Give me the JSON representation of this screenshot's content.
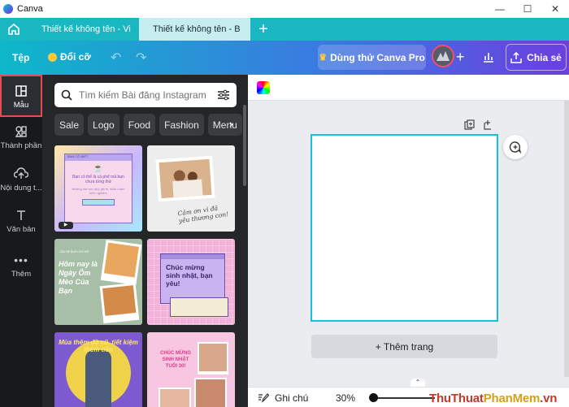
{
  "window": {
    "title": "Canva",
    "controls": [
      "—",
      "☐",
      "✕"
    ]
  },
  "tabs": [
    {
      "label": "Thiết kế không tên - Vi",
      "active": false
    },
    {
      "label": "Thiết kế không tên - B",
      "active": true
    }
  ],
  "toolbar": {
    "file": "Tệp",
    "resize": "Đổi cỡ",
    "trial": "Dùng thử Canva Pro",
    "share": "Chia sẻ"
  },
  "rail": [
    {
      "label": "Mẫu",
      "icon": "template-icon",
      "active": true
    },
    {
      "label": "Thành phần",
      "icon": "elements-icon",
      "active": false
    },
    {
      "label": "Nội dung t...",
      "icon": "upload-icon",
      "active": false
    },
    {
      "label": "Văn bản",
      "icon": "text-icon",
      "active": false
    },
    {
      "label": "Thêm",
      "icon": "more-icon",
      "active": false
    }
  ],
  "panel": {
    "search_placeholder": "Tìm kiếm Bài đăng Instagram mẫu",
    "chips": [
      "Sale",
      "Logo",
      "Food",
      "Fashion",
      "Menu"
    ]
  },
  "templates": {
    "t1_header": "BẠN CÓ BIẾT",
    "t1_text": "Bạn có thể là cà phê mà bạn chưa từng thử",
    "t1_body": "Những bài học quý giá từ nhiều năm kinh nghiệm",
    "t2_text": "Cảm ơn vì đã yêu thương con!",
    "t3_label": "CÂU BÉ BUỔI GIỜ ĐÓ",
    "t3_text": "Hôm nay là Ngày Ôm Mèo Của Bạn",
    "t4_text": "Chúc mừng sinh nhật, bạn yêu!",
    "t5_text": "Mùa thêm đồ cũ, tiết kiệm thêm tiền",
    "t6_text": "CHÚC MỪNG SINH NHẬT TUỔI 30!"
  },
  "editor": {
    "add_page": "+ Thêm trang",
    "notes": "Ghi chú",
    "zoom": "30%"
  },
  "watermark": {
    "part1": "ThuThuat",
    "part2": "PhanMem",
    "part3": ".vn"
  },
  "colors": {
    "accent": "#00c4cc",
    "brand_purple": "#7d2ae8",
    "selection": "#14c3da",
    "highlight_border": "#e34d4d"
  }
}
